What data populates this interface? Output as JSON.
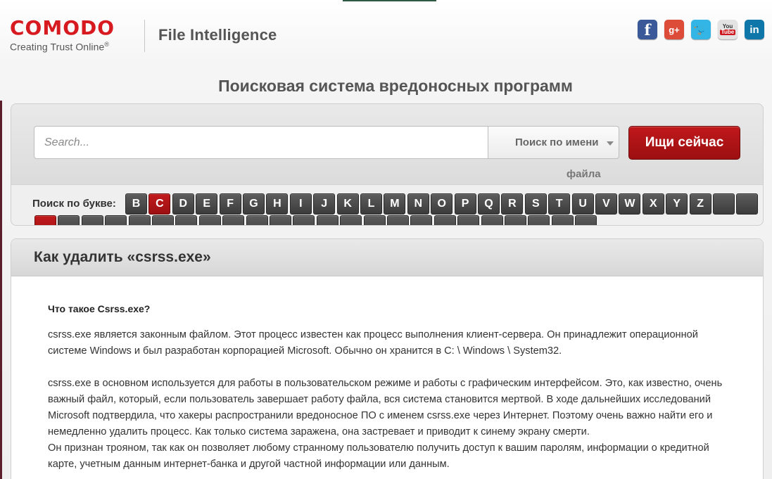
{
  "brand": {
    "logo": "COMODO",
    "tagline": "Creating Trust Online",
    "tagline_mark": "®",
    "product": "File Intelligence",
    "logo_color": "#d71920"
  },
  "social": [
    {
      "name": "facebook-icon",
      "glyph": "f",
      "color": "#3b5998",
      "cls": "fb"
    },
    {
      "name": "google-plus-icon",
      "glyph": "g+",
      "color": "#dd4b39",
      "cls": "gp"
    },
    {
      "name": "twitter-icon",
      "glyph": "🐦",
      "color": "#33b5e5",
      "cls": "tw"
    },
    {
      "name": "youtube-icon",
      "glyph": "You Tube",
      "color": "#e3e3e3",
      "cls": "yt"
    },
    {
      "name": "linkedin-icon",
      "glyph": "in",
      "color": "#0e76a8",
      "cls": "li"
    }
  ],
  "page_title": "Поисковая система вредоносных программ",
  "search": {
    "placeholder": "Search...",
    "value": "",
    "mode_line1": "Поиск по имени",
    "mode_line2": "файла",
    "button_label": "Ищи сейчас",
    "button_color": "#b01517"
  },
  "letters": {
    "label": "Поиск по букве:",
    "items": [
      "B",
      "C",
      "D",
      "E",
      "F",
      "G",
      "H",
      "I",
      "J",
      "K",
      "L",
      "M",
      "N",
      "O",
      "P",
      "Q",
      "R",
      "S",
      "T",
      "U",
      "V",
      "W",
      "X",
      "Y",
      "Z"
    ],
    "active": "C",
    "blank_count_row1": 2,
    "blank_count_row2": 24,
    "first_blank_row2_active": true
  },
  "article": {
    "title": "Как удалить «csrss.exe»",
    "question": "Что такое Csrss.exe?",
    "paragraphs": [
      "csrss.exe является законным файлом. Этот процесс известен как процесс выполнения клиент-сервера. Он принадлежит операционной системе Windows и был разработан корпорацией Microsoft. Обычно он хранится в C: \\ Windows \\ System32.",
      "",
      "csrss.exe в основном используется для работы в пользовательском режиме и работы с графическим интерфейсом. Это, как известно, очень важный файл, который, если пользователь завершает работу файла, вся система становится мертвой. В ходе дальнейших исследований Microsoft подтвердила, что хакеры распространили вредоносное ПО с именем csrss.exe через Интернет. Поэтому очень важно найти его и немедленно удалить процесс. Как только система заражена, она застревает и приводит к синему экрану смерти.",
      "Он признан трояном, так как он позволяет любому странному пользователю получить доступ к вашим паролям, информации о кредитной карте, учетным данным интернет-банка и другой частной информации или данным."
    ]
  }
}
